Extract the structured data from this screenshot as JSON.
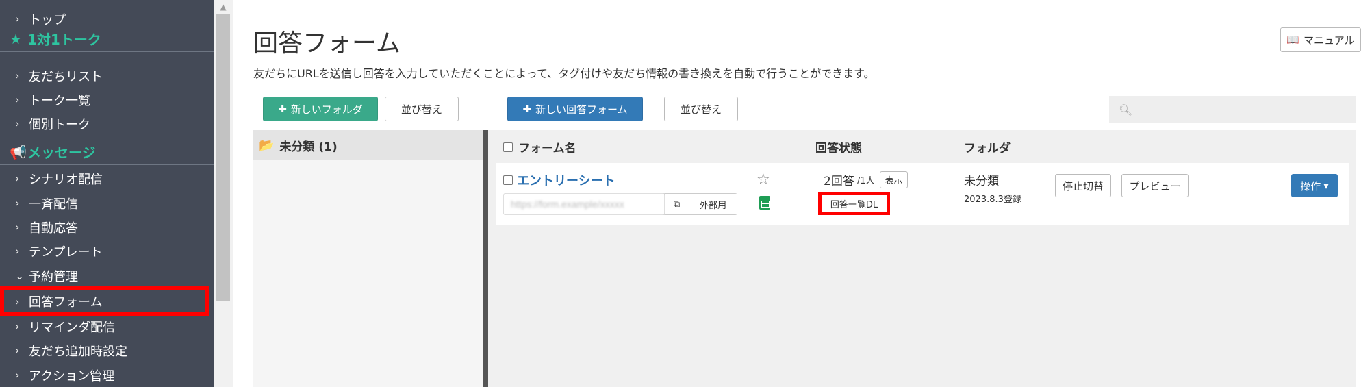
{
  "sidebar": {
    "top": "トップ",
    "section_talk": "1対1トーク",
    "friends_list": "友だちリスト",
    "talk_list": "トーク一覧",
    "individual_talk": "個別トーク",
    "section_message": "メッセージ",
    "scenario": "シナリオ配信",
    "broadcast": "一斉配信",
    "auto_reply": "自動応答",
    "template": "テンプレート",
    "reservation": "予約管理",
    "answer_form": "回答フォーム",
    "reminder": "リマインダ配信",
    "friend_add_settings": "友だち追加時設定",
    "action_management": "アクション管理"
  },
  "header": {
    "title": "回答フォーム",
    "description": "友だちにURLを送信し回答を入力していただくことによって、タグ付けや友だち情報の書き換えを自動で行うことができます。",
    "manual_label": "マニュアル"
  },
  "toolbar": {
    "new_folder": "新しいフォルダ",
    "sort_folder": "並び替え",
    "new_form": "新しい回答フォーム",
    "sort_form": "並び替え"
  },
  "folders": {
    "uncategorized": "未分類 (1)"
  },
  "table": {
    "col_name": "フォーム名",
    "col_status": "回答状態",
    "col_folder": "フォルダ"
  },
  "form": {
    "name": "エントリーシート",
    "url": "https://form.example/xxxxx",
    "external_label": "外部用",
    "answer_count": "2回答",
    "answer_people": "/1人",
    "show_label": "表示",
    "download_label": "回答一覧DL",
    "folder": "未分類",
    "registered": "2023.8.3登録",
    "stop_label": "停止切替",
    "preview_label": "プレビュー",
    "ops_label": "操作"
  },
  "colors": {
    "sidebar_bg": "#444a57",
    "accent_green": "#2ec4a0",
    "primary_blue": "#337ab7",
    "highlight_red": "#ff0000"
  }
}
